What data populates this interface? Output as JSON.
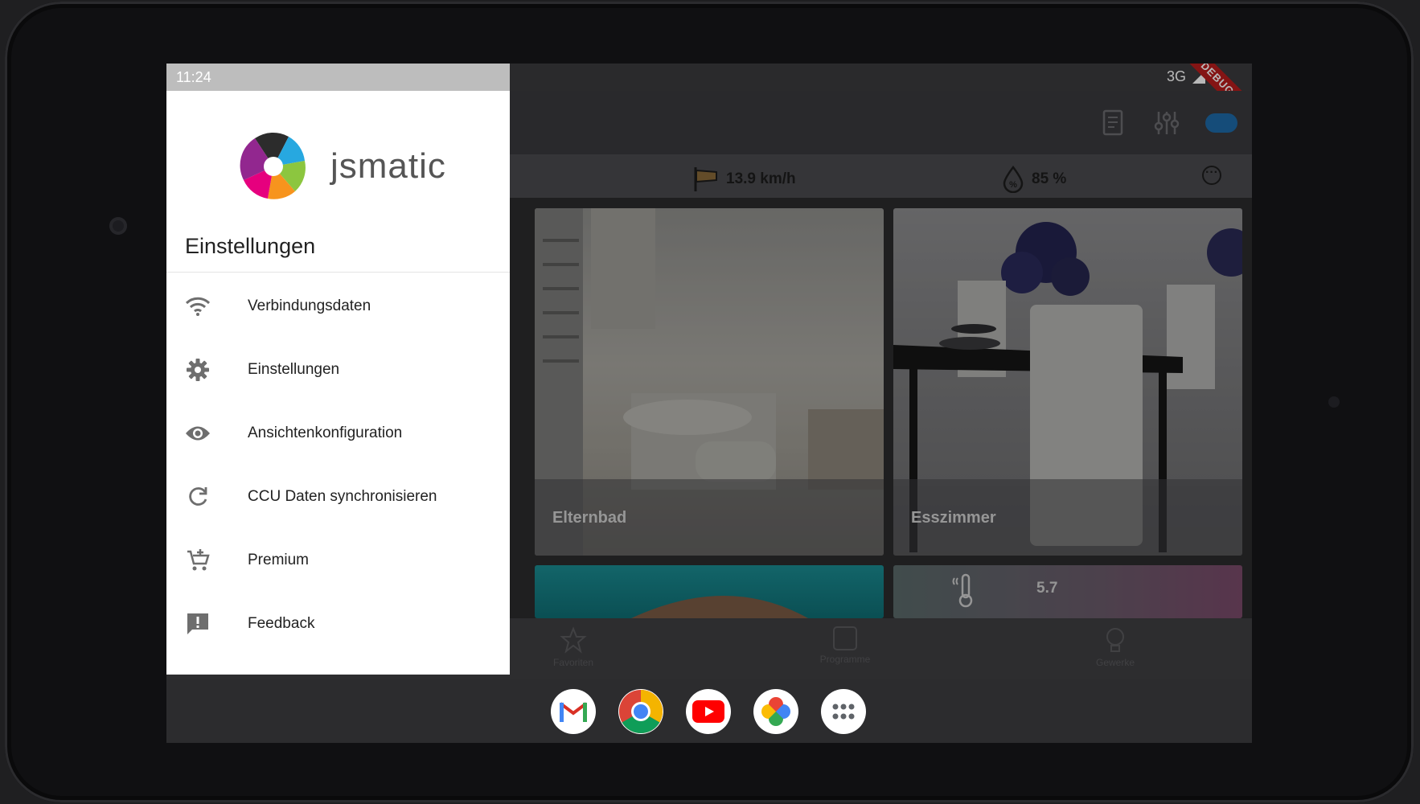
{
  "status": {
    "time": "11:24",
    "network": "3G",
    "debug_banner": "DEBUG"
  },
  "app": {
    "logo_text": "jsmatic"
  },
  "weather": {
    "wind": "13.9 km/h",
    "humidity": "85 %"
  },
  "drawer": {
    "heading": "Einstellungen",
    "items": [
      {
        "label": "Verbindungsdaten",
        "icon": "wifi-icon"
      },
      {
        "label": "Einstellungen",
        "icon": "gear-icon"
      },
      {
        "label": "Ansichtenkonfiguration",
        "icon": "eye-icon"
      },
      {
        "label": "CCU Daten synchronisieren",
        "icon": "sync-icon"
      },
      {
        "label": "Premium",
        "icon": "cart-icon"
      },
      {
        "label": "Feedback",
        "icon": "feedback-icon"
      }
    ]
  },
  "rooms": [
    {
      "name": "Elternbad"
    },
    {
      "name": "Esszimmer"
    }
  ],
  "tiles": {
    "temperature_value": "5.7"
  },
  "bottom_nav": [
    {
      "label": "Favoriten",
      "icon": "star-icon"
    },
    {
      "label": "Programme",
      "icon": "program-icon"
    },
    {
      "label": "Gewerke",
      "icon": "bulb-icon"
    }
  ],
  "dock": [
    {
      "name": "gmail-icon"
    },
    {
      "name": "chrome-icon"
    },
    {
      "name": "youtube-icon"
    },
    {
      "name": "photos-icon"
    },
    {
      "name": "app-drawer-icon"
    }
  ],
  "colors": {
    "accent_blue": "#1e6aa8",
    "debug_red": "#b71c1c",
    "drawer_bg": "#ffffff"
  }
}
